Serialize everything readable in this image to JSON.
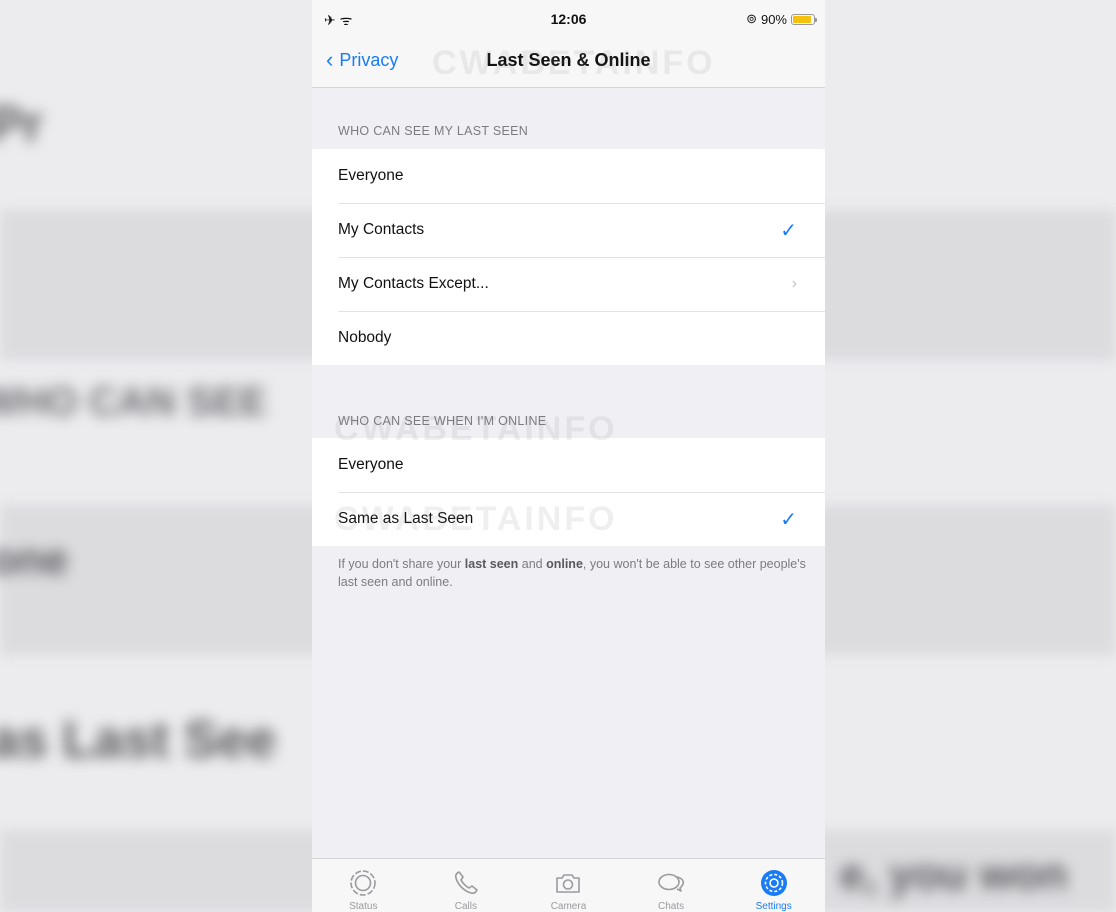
{
  "status_bar": {
    "left_icons": "✈ ᯤ",
    "time": "12:06",
    "location_icon": "⊚",
    "battery_percent": "90%",
    "battery_level": 0.9,
    "battery_color": "#f4c20d"
  },
  "nav": {
    "back_label": "Privacy",
    "title": "Last Seen & Online",
    "accent_color": "#1a7cf5"
  },
  "watermark_text": "CWABETAINFO",
  "last_seen_section": {
    "header": "WHO CAN SEE MY LAST SEEN",
    "options": [
      "Everyone",
      "My Contacts",
      "My Contacts Except...",
      "Nobody"
    ],
    "selected": "My Contacts"
  },
  "online_section": {
    "header": "WHO CAN SEE WHEN I'M ONLINE",
    "options": [
      "Everyone",
      "Same as Last Seen"
    ],
    "selected": "Same as Last Seen"
  },
  "footnote": {
    "part1": "If you don't share your ",
    "bold1": "last seen",
    "part2": " and ",
    "bold2": "online",
    "part3": ", you won't be able to see other people's last seen and online."
  },
  "tabs": [
    {
      "label": "Status",
      "icon": "status-icon",
      "active": false
    },
    {
      "label": "Calls",
      "icon": "phone-icon",
      "active": false
    },
    {
      "label": "Camera",
      "icon": "camera-icon",
      "active": false
    },
    {
      "label": "Chats",
      "icon": "chat-bubbles-icon",
      "active": false
    },
    {
      "label": "Settings",
      "icon": "gear-icon",
      "active": true
    }
  ]
}
